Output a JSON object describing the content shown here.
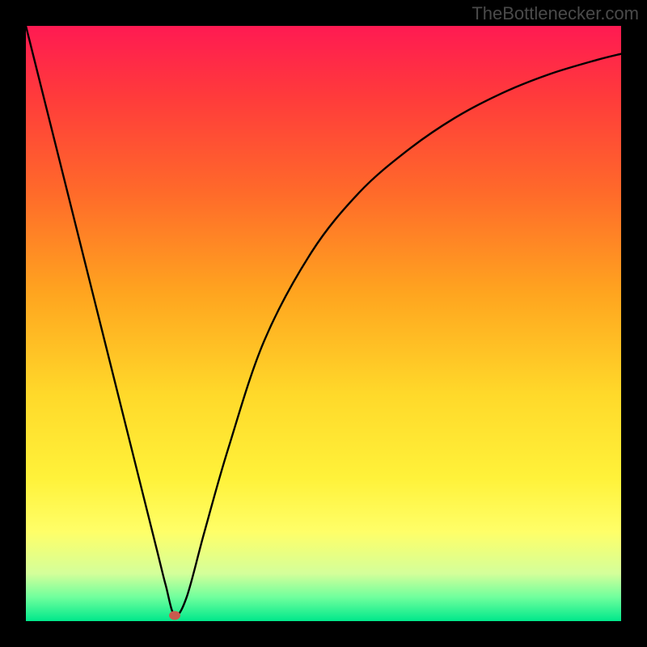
{
  "watermark": "TheBottlenecker.com",
  "chart_data": {
    "type": "line",
    "title": "",
    "xlabel": "",
    "ylabel": "",
    "xlim": [
      0,
      100
    ],
    "ylim": [
      0,
      100
    ],
    "x": [
      0,
      5,
      10,
      15,
      19,
      22,
      23.5,
      25,
      27,
      30,
      34,
      40,
      48,
      56,
      64,
      72,
      80,
      88,
      96,
      100
    ],
    "values": [
      100,
      80,
      60,
      40,
      24,
      12,
      6,
      1,
      4,
      15,
      29,
      47,
      62,
      72,
      79,
      84.5,
      88.7,
      91.9,
      94.3,
      95.3
    ],
    "marker": {
      "x": 25,
      "y": 1
    },
    "background": {
      "type": "vertical-gradient",
      "stops": [
        {
          "pos": 0,
          "color": "#ff1a52"
        },
        {
          "pos": 12,
          "color": "#ff3b3b"
        },
        {
          "pos": 28,
          "color": "#ff6a2a"
        },
        {
          "pos": 45,
          "color": "#ffa51f"
        },
        {
          "pos": 62,
          "color": "#ffd92a"
        },
        {
          "pos": 76,
          "color": "#fff23a"
        },
        {
          "pos": 85,
          "color": "#ffff68"
        },
        {
          "pos": 92,
          "color": "#d4ff9a"
        },
        {
          "pos": 96,
          "color": "#6fff9d"
        },
        {
          "pos": 100,
          "color": "#00e88b"
        }
      ]
    }
  }
}
